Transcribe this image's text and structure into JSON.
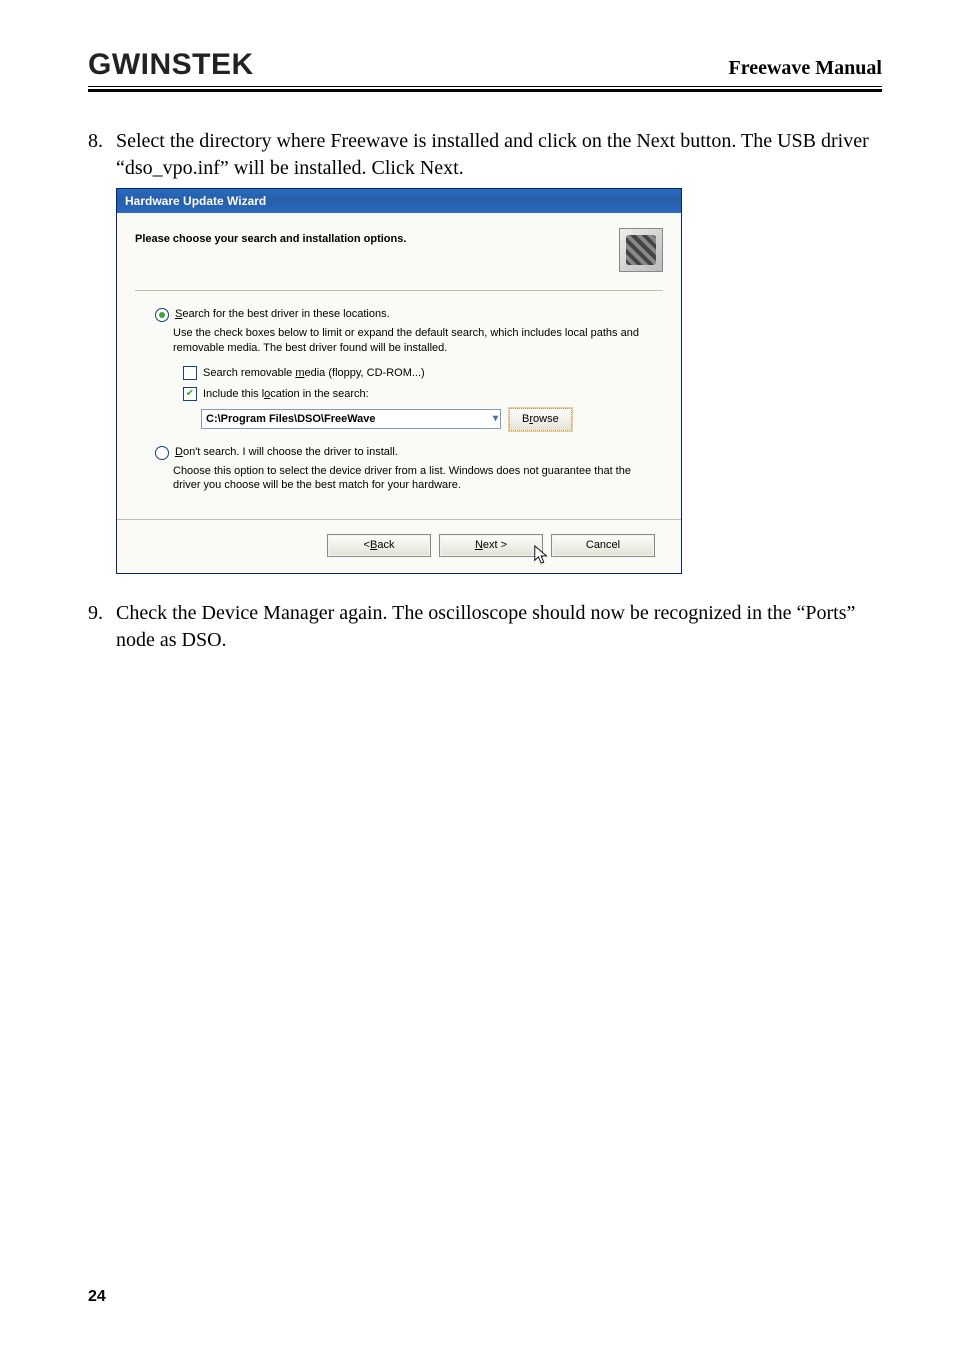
{
  "header": {
    "logo_text": "GWINSTEK",
    "manual_title": "Freewave Manual"
  },
  "steps": {
    "s8": {
      "num": "8.",
      "text": "Select the directory where Freewave is installed and click on the Next button. The USB driver “dso_vpo.inf” will be installed. Click Next."
    },
    "s9": {
      "num": "9.",
      "text": "Check the Device Manager again. The oscilloscope should now be recognized in the “Ports” node as DSO."
    }
  },
  "dialog": {
    "title": "Hardware Update Wizard",
    "heading": "Please choose your search and installation options.",
    "opt1_label": "Search for the best driver in these locations.",
    "opt1_help": "Use the check boxes below to limit or expand the default search, which includes local paths and removable media. The best driver found will be installed.",
    "chk1_label": "Search removable media (floppy, CD-ROM...)",
    "chk2_label": "Include this location in the search:",
    "path_value": "C:\\Program Files\\DSO\\FreeWave",
    "browse_label": "Browse",
    "opt2_label": "Don't search. I will choose the driver to install.",
    "opt2_help": "Choose this option to select the device driver from a list.  Windows does not guarantee that the driver you choose will be the best match for your hardware.",
    "back_label": "< Back",
    "next_label": "Next >",
    "cancel_label": "Cancel"
  },
  "page": {
    "number": "24"
  }
}
